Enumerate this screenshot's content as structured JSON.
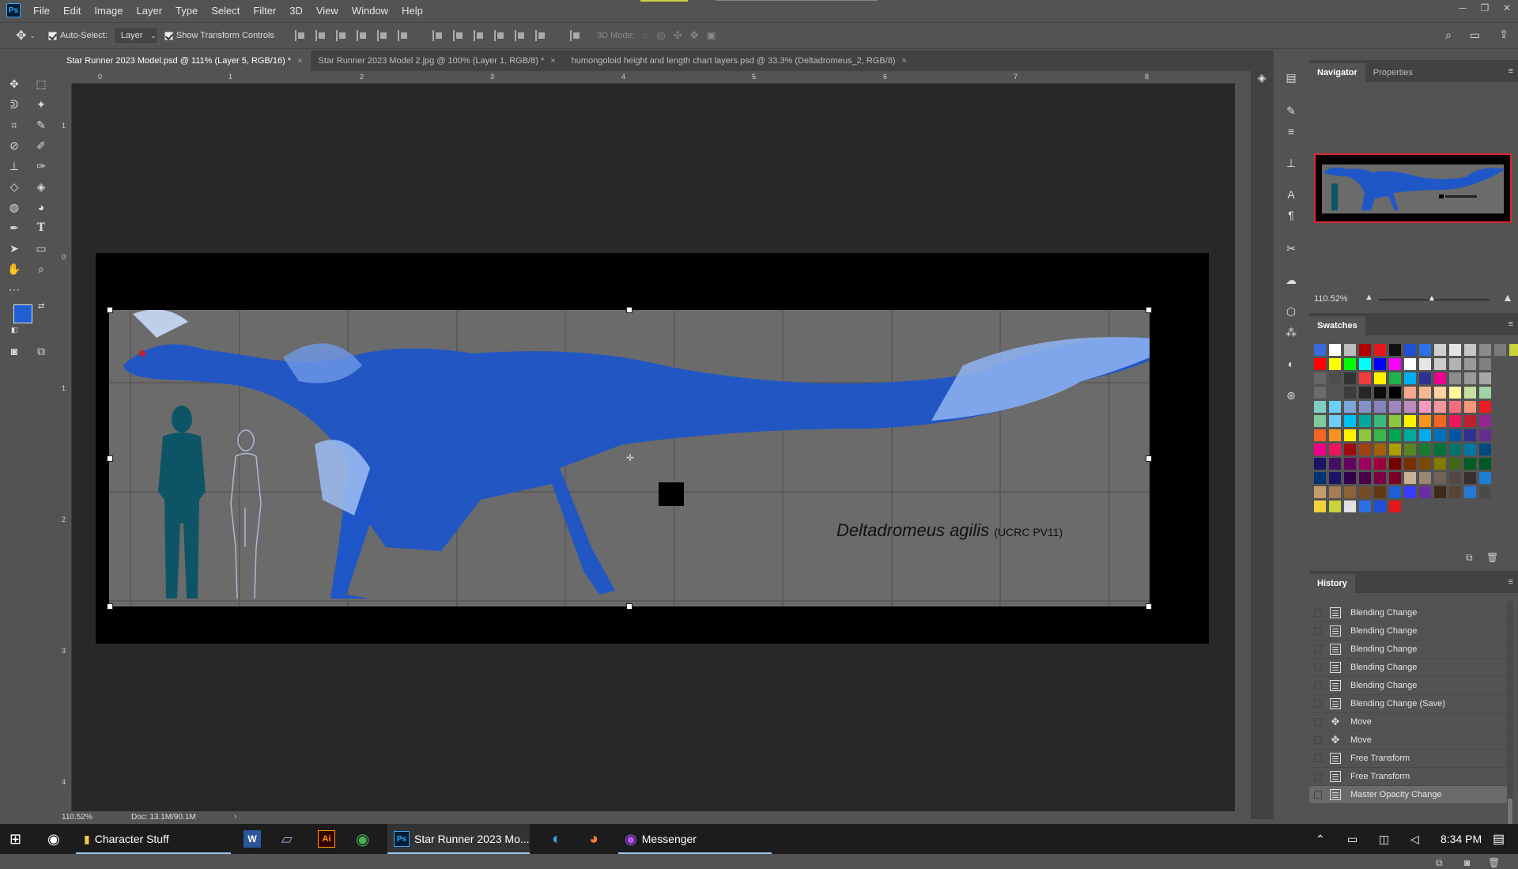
{
  "app": {
    "logo": "Ps"
  },
  "menu": [
    "File",
    "Edit",
    "Image",
    "Layer",
    "Type",
    "Select",
    "Filter",
    "3D",
    "View",
    "Window",
    "Help"
  ],
  "options": {
    "auto_select_label": "Auto-Select:",
    "auto_select_value": "Layer",
    "show_transform_label": "Show Transform Controls",
    "mode_3d_label": "3D Mode:"
  },
  "tabs": [
    {
      "label": "Star Runner 2023 Model.psd @ 111% (Layer 5, RGB/16) *",
      "active": true
    },
    {
      "label": "Star Runner 2023 Model 2.jpg @ 100% (Layer 1, RGB/8) *",
      "active": false
    },
    {
      "label": "humongoloid height and length chart layers.psd @ 33.3% (Deltadromeus_2, RGB/8)",
      "active": false
    }
  ],
  "ruler": {
    "top": [
      "0",
      "1",
      "2",
      "3",
      "4",
      "5",
      "6",
      "7",
      "8"
    ],
    "left": [
      "1",
      "0",
      "1",
      "2",
      "3",
      "4"
    ]
  },
  "canvas": {
    "species": "Deltadromeus agilis",
    "specimen": "(UCRC PV11)"
  },
  "status": {
    "zoom": "110.52%",
    "doc": "Doc: 13.1M/90.1M",
    "arrow": "›"
  },
  "navigator": {
    "tab": "Navigator",
    "tab2": "Properties",
    "zoom": "110.52%"
  },
  "swatches": {
    "title": "Swatches"
  },
  "history": {
    "title": "History",
    "items": [
      {
        "label": "Blending Change",
        "icon": "doc"
      },
      {
        "label": "Blending Change",
        "icon": "doc"
      },
      {
        "label": "Blending Change",
        "icon": "doc"
      },
      {
        "label": "Blending Change",
        "icon": "doc"
      },
      {
        "label": "Blending Change",
        "icon": "doc"
      },
      {
        "label": "Blending Change (Save)",
        "icon": "doc"
      },
      {
        "label": "Move",
        "icon": "move"
      },
      {
        "label": "Move",
        "icon": "move"
      },
      {
        "label": "Free Transform",
        "icon": "doc"
      },
      {
        "label": "Free Transform",
        "icon": "doc"
      },
      {
        "label": "Master Opacity Change",
        "icon": "doc"
      }
    ]
  },
  "taskbar": {
    "folder": "Character Stuff",
    "photoshop": "Star Runner 2023 Mo...",
    "messenger": "Messenger",
    "time": "8:34 PM",
    "word_logo": "W",
    "illustrator_logo": "Ai",
    "ps_logo": "Ps"
  },
  "colors": {
    "foreground": "#1f5fd6",
    "background": "#ffffff",
    "accent": "#31a8ff"
  }
}
